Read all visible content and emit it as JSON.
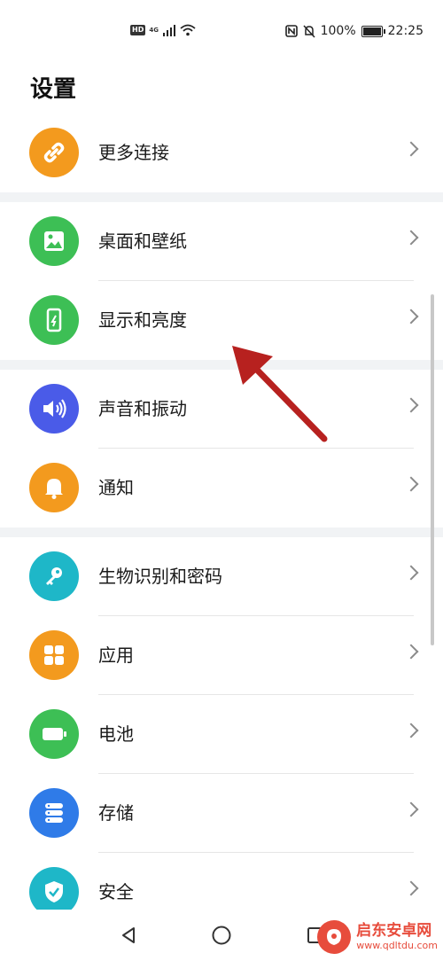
{
  "status_bar": {
    "left_badges": [
      "HD",
      "4G"
    ],
    "battery_percent": "100%",
    "time": "22:25"
  },
  "page": {
    "title": "设置"
  },
  "sections": [
    {
      "items": [
        {
          "label": "更多连接",
          "icon": "link-icon",
          "color": "#f39a1e"
        }
      ]
    },
    {
      "items": [
        {
          "label": "桌面和壁纸",
          "icon": "image-icon",
          "color": "#3dbf55"
        },
        {
          "label": "显示和亮度",
          "icon": "phone-brightness-icon",
          "color": "#3dbf55"
        }
      ]
    },
    {
      "items": [
        {
          "label": "声音和振动",
          "icon": "speaker-icon",
          "color": "#4a5be8"
        },
        {
          "label": "通知",
          "icon": "bell-icon",
          "color": "#f39a1e"
        }
      ]
    },
    {
      "items": [
        {
          "label": "生物识别和密码",
          "icon": "key-icon",
          "color": "#1eb7c8"
        },
        {
          "label": "应用",
          "icon": "apps-grid-icon",
          "color": "#f39a1e"
        },
        {
          "label": "电池",
          "icon": "battery-icon",
          "color": "#3dbf55"
        },
        {
          "label": "存储",
          "icon": "storage-icon",
          "color": "#2f7be8"
        },
        {
          "label": "安全",
          "icon": "shield-icon",
          "color": "#1eb7c8"
        }
      ]
    }
  ],
  "navigation": [
    "back-icon",
    "home-icon",
    "recents-icon"
  ],
  "watermark": {
    "name": "启东安卓网",
    "url": "www.qdltdu.com"
  },
  "annotation": {
    "arrow_color": "#b7211f"
  }
}
